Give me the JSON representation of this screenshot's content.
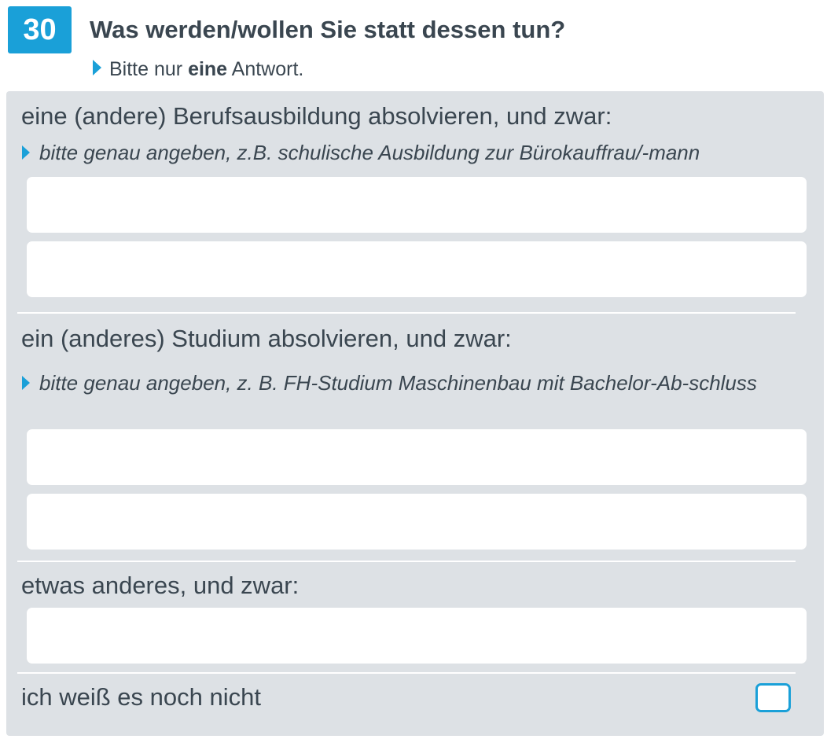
{
  "question": {
    "number": "30",
    "title": "Was werden/wollen Sie statt dessen tun?",
    "hint_prefix": "Bitte nur ",
    "hint_bold": "eine",
    "hint_suffix": " Antwort."
  },
  "options": {
    "ausbildung": {
      "label": "eine (andere) Berufsausbildung absolvieren, und zwar:",
      "instruction": "bitte genau angeben, z.B. schulische Ausbildung zur Bürokauffrau/-mann",
      "field1_value": "",
      "field2_value": ""
    },
    "studium": {
      "label": "ein (anderes) Studium absolvieren, und zwar:",
      "instruction": "bitte genau angeben, z. B. FH-Studium Maschinenbau mit Bachelor-Ab-schluss",
      "field1_value": "",
      "field2_value": ""
    },
    "anderes": {
      "label": "etwas anderes, und zwar:",
      "field_value": ""
    },
    "weiss_nicht": {
      "label": "ich weiß es noch nicht",
      "checked": false
    }
  },
  "colors": {
    "accent": "#1aa0d8",
    "panel": "#dde1e5",
    "text": "#3a4650"
  }
}
